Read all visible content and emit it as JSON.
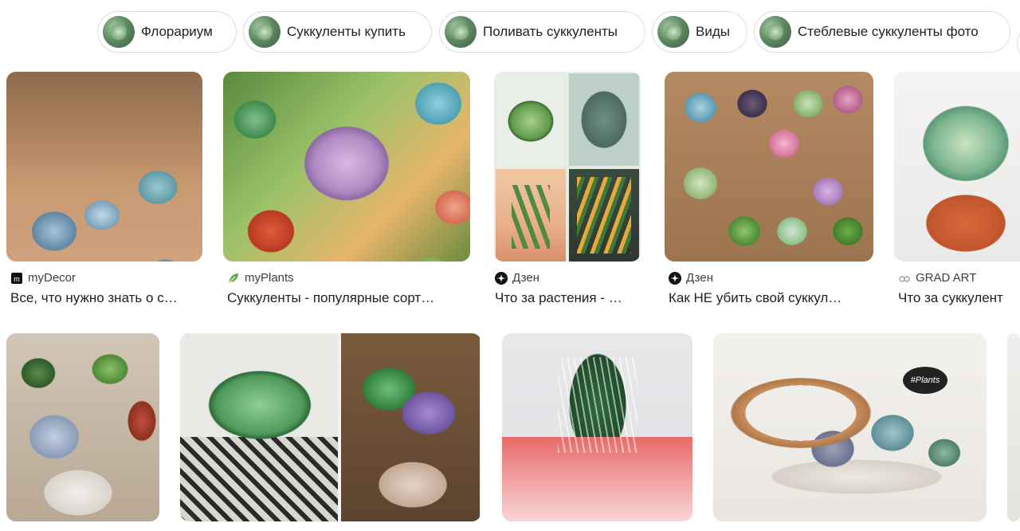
{
  "chips": [
    {
      "label": "Флорариум"
    },
    {
      "label": "Суккуленты купить"
    },
    {
      "label": "Поливать суккуленты"
    },
    {
      "label": "Виды"
    },
    {
      "label": "Стеблевые суккуленты фото"
    }
  ],
  "results_row1": [
    {
      "source": "myDecor",
      "title": "Все, что нужно знать о с…",
      "source_icon": "mydecor-logo-icon"
    },
    {
      "source": "myPlants",
      "title": "Суккуленты - популярные сорт…",
      "source_icon": "leaf-icon"
    },
    {
      "source": "Дзен",
      "title": "Что за растения - …",
      "source_icon": "dzen-logo-icon"
    },
    {
      "source": "Дзен",
      "title": "Как НЕ убить свой суккул…",
      "source_icon": "dzen-logo-icon"
    },
    {
      "source": "GRAD ART",
      "title": "Что за суккулент",
      "source_icon": "gradart-logo-icon"
    }
  ],
  "results_row2": [
    {
      "image": "succulents-in-white-pots"
    },
    {
      "image": "succulent-bowl-arrangements"
    },
    {
      "image": "haworthia-in-glass"
    },
    {
      "image": "succulent-tray-with-sign",
      "sign_text": "#Plants"
    }
  ],
  "colors": {
    "chip_border": "#dadce0",
    "text": "#202124",
    "source_text": "#3c4043"
  }
}
